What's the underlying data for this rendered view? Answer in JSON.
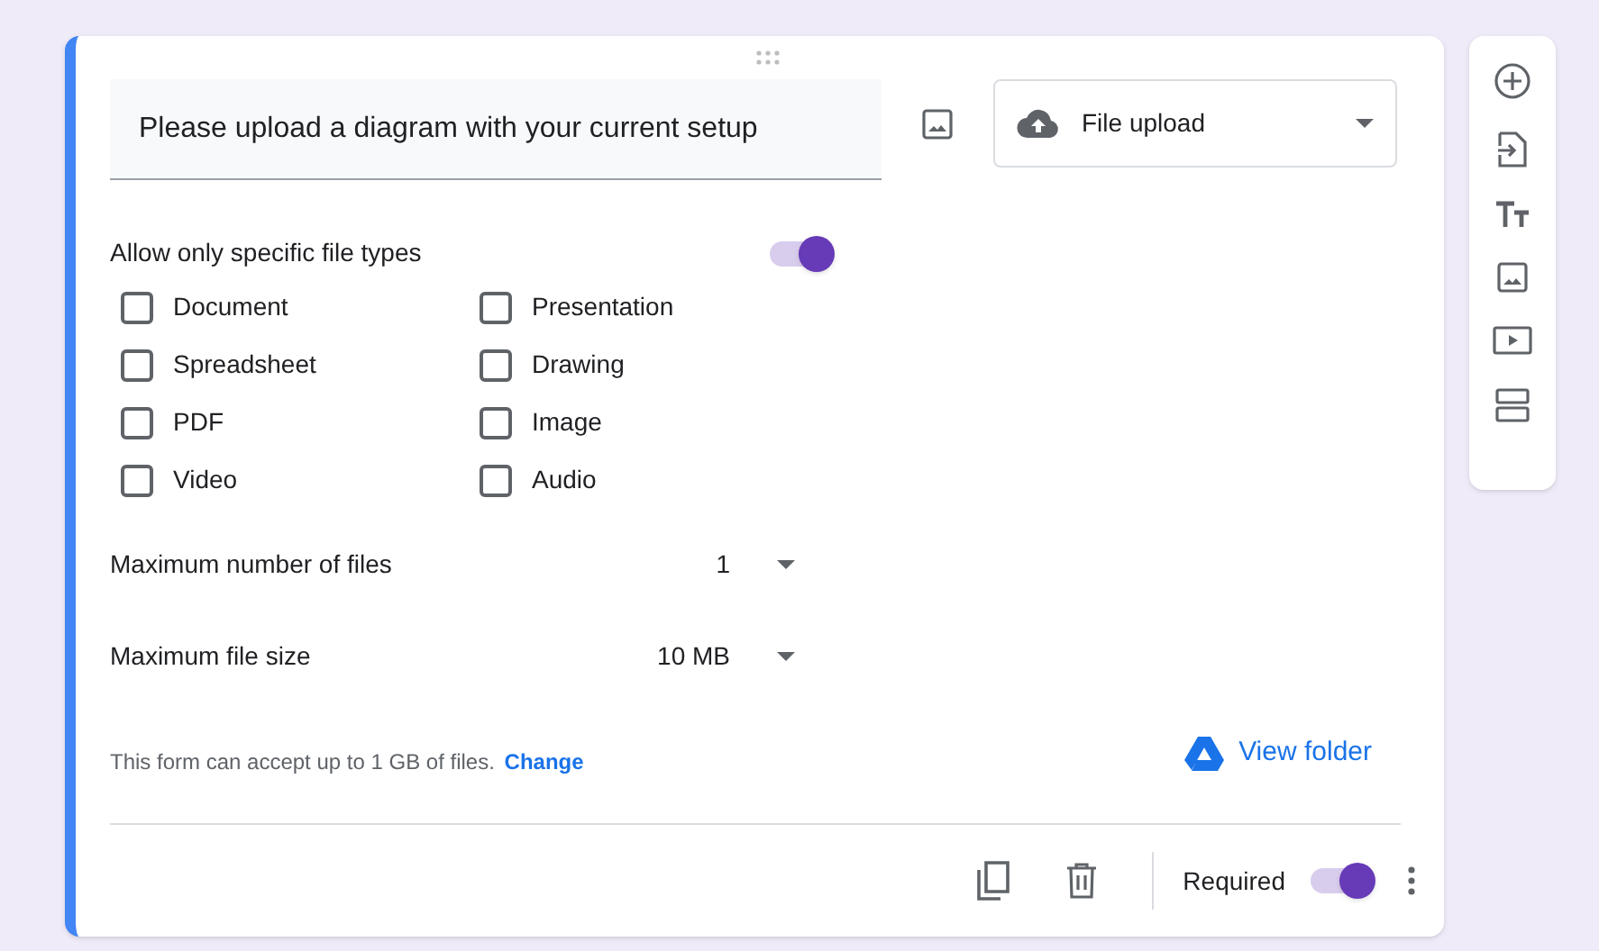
{
  "question": {
    "title": "Please upload a diagram with your current setup",
    "type_label": "File upload"
  },
  "file_types": {
    "label": "Allow only specific file types",
    "on": true,
    "options": [
      {
        "label": "Document",
        "checked": false
      },
      {
        "label": "Presentation",
        "checked": false
      },
      {
        "label": "Spreadsheet",
        "checked": false
      },
      {
        "label": "Drawing",
        "checked": false
      },
      {
        "label": "PDF",
        "checked": false
      },
      {
        "label": "Image",
        "checked": false
      },
      {
        "label": "Video",
        "checked": false
      },
      {
        "label": "Audio",
        "checked": false
      }
    ]
  },
  "settings": [
    {
      "label": "Maximum number of files",
      "value": "1"
    },
    {
      "label": "Maximum file size",
      "value": "10 MB"
    }
  ],
  "note": {
    "text": "This form can accept up to 1 GB of files.",
    "link": "Change"
  },
  "view_folder": "View folder",
  "footer": {
    "required_label": "Required",
    "required": true
  }
}
